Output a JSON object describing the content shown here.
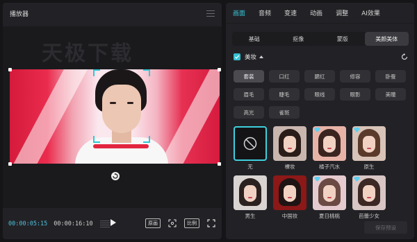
{
  "player": {
    "title": "播放器",
    "watermark": "天极下载",
    "timecode_current": "00:00:05:15",
    "timecode_total": "00:00:16:10",
    "ctrl_original": "原画",
    "ctrl_ratio": "比例"
  },
  "panel": {
    "main_tabs": [
      "画面",
      "音频",
      "变速",
      "动画",
      "调整",
      "AI效果"
    ],
    "active_main_tab": "画面",
    "sub_tabs": [
      "基础",
      "抠像",
      "蒙版",
      "美颜美体"
    ],
    "active_sub_tab": "美颜美体",
    "section_title": "美妆",
    "section_checked": true,
    "chips": [
      "套装",
      "口红",
      "腮红",
      "修容",
      "卧蚕",
      "眉毛",
      "睫毛",
      "眼线",
      "眼影",
      "美瞳",
      "高光",
      "雀斑"
    ],
    "active_chip": "套装",
    "looks": [
      {
        "label": "无",
        "selected": true
      },
      {
        "label": "裸妆",
        "hair": "#2a1c18",
        "bg": "#c9b6ae"
      },
      {
        "label": "橘子汽水",
        "hair": "#3a2420",
        "bg": "#e8b3a7",
        "badge": true
      },
      {
        "label": "原生",
        "hair": "#5a3a2a",
        "bg": "#d8c3b8",
        "badge": true
      },
      {
        "label": "男生",
        "hair": "#2b2220",
        "bg": "#d9d4d2"
      },
      {
        "label": "中国妆",
        "hair": "#1f1414",
        "bg": "#8c1818"
      },
      {
        "label": "夏日桃桃",
        "hair": "#6b4a44",
        "bg": "#e5cbd0",
        "badge": true
      },
      {
        "label": "芭蕾少女",
        "hair": "#3c2824",
        "bg": "#d8c6c4",
        "badge": true
      }
    ],
    "save_label": "保存预设"
  },
  "colors": {
    "accent": "#39c7d9",
    "panel_bg": "#222226",
    "app_bg": "#151518"
  }
}
